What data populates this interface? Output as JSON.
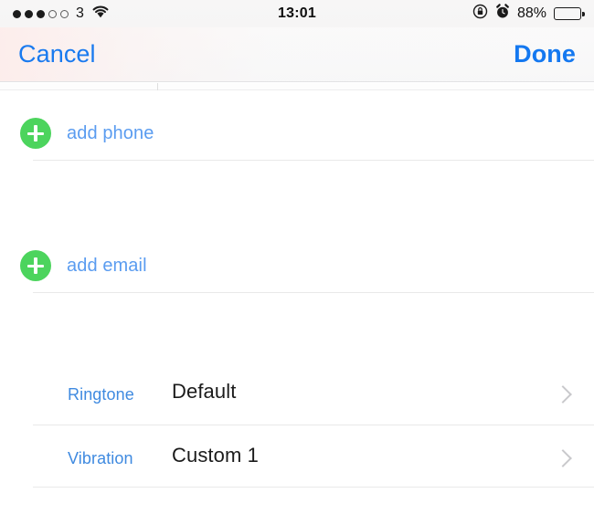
{
  "status_bar": {
    "signal_dots_filled": 3,
    "signal_dots_empty": 2,
    "carrier": "3",
    "wifi_icon": "wifi-icon",
    "time": "13:01",
    "rotation_lock_icon": "rotation-lock-icon",
    "alarm_icon": "alarm-clock-icon",
    "battery_percent": "88%",
    "battery_level": 88
  },
  "nav_bar": {
    "cancel_label": "Cancel",
    "done_label": "Done"
  },
  "content": {
    "add_phone": {
      "icon": "add-plus-icon",
      "label": "add phone"
    },
    "add_email": {
      "icon": "add-plus-icon",
      "label": "add email"
    },
    "ringtone": {
      "label": "Ringtone",
      "value": "Default",
      "chevron": "chevron-right-icon"
    },
    "vibration": {
      "label": "Vibration",
      "value": "Custom 1",
      "chevron": "chevron-right-icon"
    }
  },
  "colors": {
    "accent_blue": "#1a7aef",
    "label_blue": "#3f8ae0",
    "add_blue": "#5a9cf0",
    "green": "#4cd45d",
    "separator": "#e9e9e9",
    "chevron_gray": "#c9c9cc"
  }
}
